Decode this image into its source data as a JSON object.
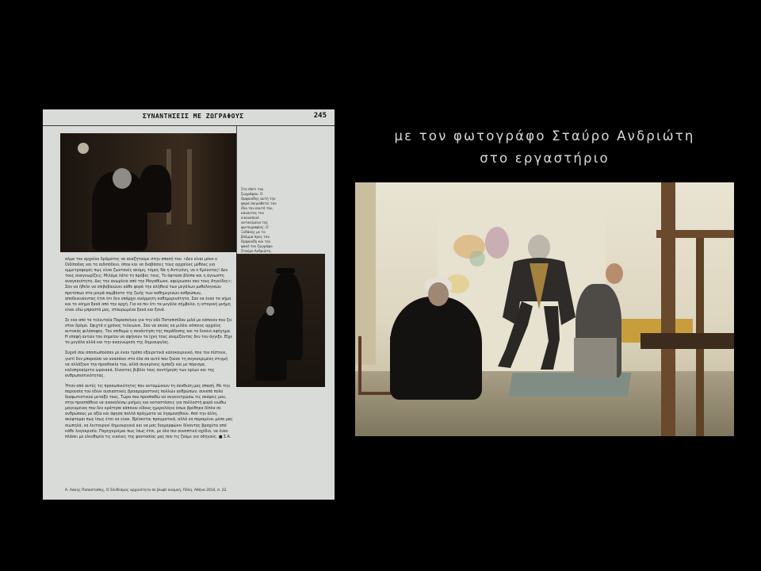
{
  "scanned_page": {
    "header_title": "ΣΥΝΑΝΤΗΣΕΙΣ ΜΕ ΖΩΓΡΑΦΟΥΣ",
    "page_number": "245",
    "side_caption": "Στο σπίτι του ζωγράφου. Ο Ορφανίδης αυτή την φορά σκηνοθετεί τον ίδιο τον εαυτό του, κάνοντας τον εικονοποιό αντικείμενο της φωτογραφίας. Ο Ξυδάκης με το βλέμμα προς τον Ορφανίδη και τον φακό τον ζωγράφο Σταύρο Ανδριώτη.",
    "paragraphs": [
      "αλμα του αρχαίου δράματος να αναζητούμε στην σπασή του. «Δεν είναι μόνο ο Οιδίποδας και το αιδιπόδειο, όπου και να διαβάσεις τους αρχαίους μύθους για ομμετροφορές πως είναι ζωντανές ακόμη, τόμος Να η Αντιγόνη, να ο Κρέοντας! Δεν τους αναγνωρίζεις; Μιλάμε λάτο τη πρόβες τους. Το άφτασο βλέπα και η άγνωστη αναγκαιότητα. Δες την ανωρίεια από την Μαγαθίωνα, αφιέρωσαν σαν τους Ατρείδες»; Σαν να ήθελε να επιβεβαιώνει κάθε φορά την αλήθεια των μεγάλων μυθολογικών προτύπων στα μικρά συμβάντα της ζωής των καθημερινών ανθρώπων, αποδεικνύοντας έτσι ότι δεν υπάρχει ανόρμητη καθημερινότητα. Σαν να έναν τα νήμα και το νόημα ξανά από την αρχή. Για να πει ότι τα μεγάλα σήμβολα, η ιστορική μνήμη είναι εδώ μπροστά μας, σταυρωμένα ξανά και ξανά.",
      "Σε ένα από τα τελευταία Παρασκήνια για την οδό Παταπιπίδου μιλά με κάποιον που ζει στον δρόμο. Σφιχτά ο χρόνος τελειώνει. Σαν να ακούς να μιλάει κάποιος αρχαίος αυτοκάς φιλόσοφος. Τον επιθυμώ η συνάντηση της παράδοσης και το δικαιό αφήγημα. Η επαφή αυτών του σημείου να αφήνουν τα ίχνη τους ανεμίζοντας δεν τον άγγιξε. Είχε το μεγάλα αλλά και την αναγνώριση της δημιουργίας.",
      "Συχνά σου αποσιωπούσαν με έναν τρόπο εξαιρετικά καλοκαιρινικό, που τον πίστευε, γιατί δεν μπορούσε να ανασάνει στα όλα σα αυτό που ζούσε τη συγκεκριμένη στιγμή να αλλάζουν την προσδοκία του, αλλά συγκρίνεις έμπαζε και με πόρισμα, καλοπροαίρετα ωραιακά, δίνοντας βιβλίο τους συντήρηση των ορίων και της ανθρωπιστικότητας.",
      "Ήταν από αυτές τις προσωπικότητες που ανταμώνουν τη σύνθεση μας σπασή. Με την παρουσία του έδινε ουσιαστικές βρασμοραστικές πολλών ανθρώπων, συνεπά πολύ διαφωτιστικού μεταξύ τους. Τώρα που προσπαθώ να συγκεντρώσω τις σκέψεις μου, στην προσπάθεια να ανακαλέσω μνήμες και καταστάσεις για πολλοστή φορά νιώθω μαγευμένος που δεν κράτησα κάποιου είδους ημερολόγιο όσων βρέθηκα δίπλα σε ανθρώπους με αξία και άφησα πολλά πράγματα να λησμονηθούν. Από την άλλη, σκέφτομαι πως ίσως έτσι να είναι. Βρίσκεται πραγματικά, αλλά να παραμένει μέσα μας σιωπηλά, να λειτουργεί δημιουργικά και να μας διαμορφώνει δίνοντας βραχύτα από κάθε λογοκρισία. Παρηγοριέμαι πως ίσως έτσι, με όλο πιο συνοπτικό σχέδιο, να έναν πλάσει με ελευθερία τις εικόνες της φαντασίας μας που τις ζούμε για οδηγούς. ■ Σ.Α."
    ],
    "footnote": "Ά. Λάκης Παπασταθης, Ο Σύνδεσμος αρχαιότητα σε βιωβί αναμνή, Πόλη, Αθήνα 2014, σ. 22."
  },
  "caption": {
    "line1": "με τον φωτογράφο Σταύρο Ανδριώτη",
    "line2": "στο εργαστήριο"
  },
  "colors": {
    "background": "#000000",
    "page": "#d9dbd8",
    "caption_text": "#d9d9d9"
  }
}
